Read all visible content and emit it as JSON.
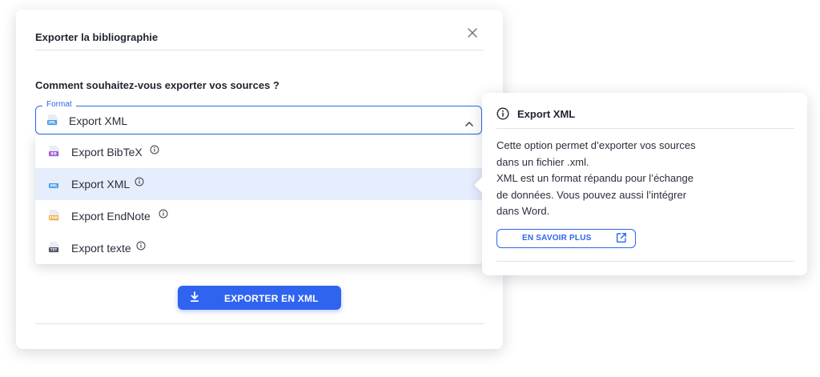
{
  "modal": {
    "title": "Exporter la bibliographie",
    "question": "Comment souhaitez-vous exporter vos sources ?",
    "select": {
      "legend": "Format",
      "value": "Export XML",
      "value_icon": "xml-file-icon"
    },
    "options": [
      {
        "label": "Export BibTeX",
        "tag": "BIB",
        "color": "#9b59d0",
        "icon": "bib-file-icon",
        "selected": false
      },
      {
        "label": "Export XML",
        "tag": "XML",
        "color": "#3d9be9",
        "icon": "xml-file-icon",
        "selected": true
      },
      {
        "label": "Export EndNote",
        "tag": "ENW",
        "color": "#f0a93b",
        "icon": "endnote-file-icon",
        "selected": false
      },
      {
        "label": "Export texte",
        "tag": "TXT",
        "color": "#4a4f5c",
        "icon": "txt-file-icon",
        "selected": false
      }
    ],
    "export_button": "EXPORTER EN XML"
  },
  "tooltip": {
    "title": "Export XML",
    "body_lines": [
      "Cette option permet d’exporter vos sources",
      "dans un fichier .xml.",
      "XML est un format répandu pour l’échange",
      "de données. Vous pouvez aussi l’intégrer",
      "dans Word."
    ],
    "learn_more": "EN SAVOIR PLUS"
  },
  "colors": {
    "accent": "#2f64f0",
    "selected_row": "#e6edfd",
    "divider": "#dfe2e8"
  }
}
